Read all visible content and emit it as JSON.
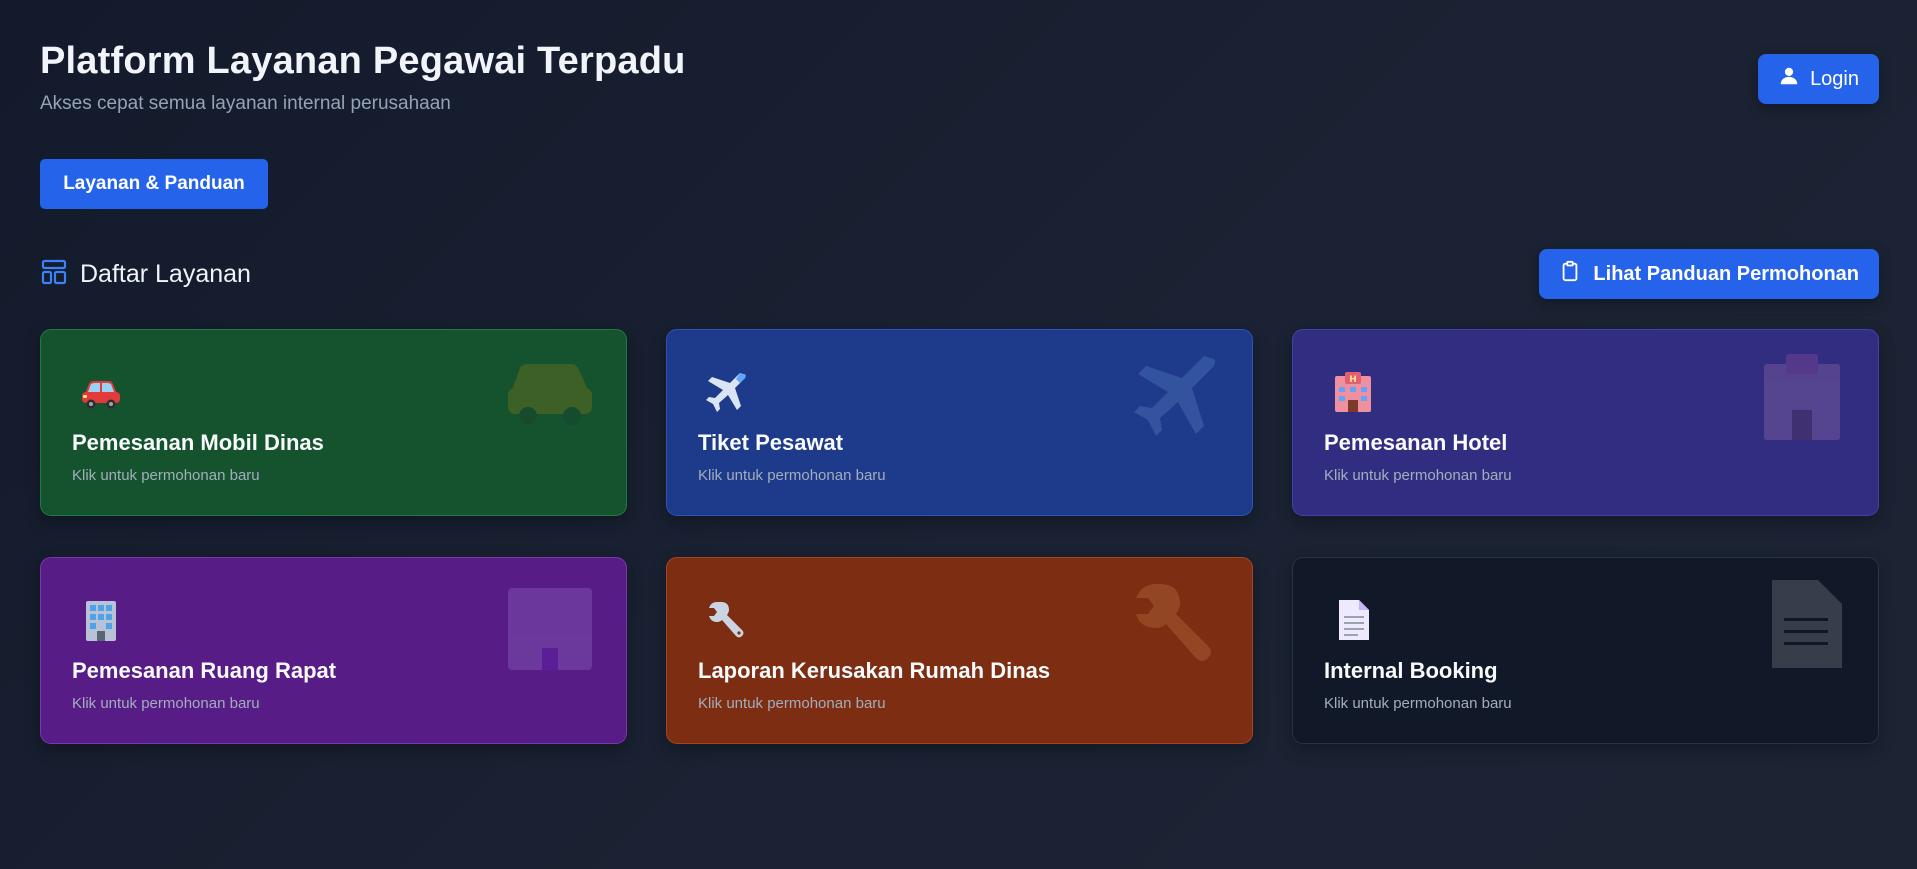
{
  "header": {
    "title": "Platform Layanan Pegawai Terpadu",
    "subtitle": "Akses cepat semua layanan internal perusahaan"
  },
  "login": {
    "label": "Login",
    "icon": "user-icon"
  },
  "guide_button": {
    "label": "Layanan & Panduan"
  },
  "section": {
    "title": "Daftar Layanan",
    "icon": "layout-icon"
  },
  "panduan_button": {
    "label": "Lihat Panduan Permohonan",
    "icon": "clipboard-icon"
  },
  "colors": {
    "accent": "#2563eb",
    "background": "#161d2d",
    "card_green": "#14532d",
    "card_blue": "#1e3a8a",
    "card_indigo": "#312e81",
    "card_purple": "#581c87",
    "card_orange": "#7c2d12",
    "card_dark": "#111827"
  },
  "services": [
    {
      "title": "Pemesanan Mobil Dinas",
      "subtitle": "Klik untuk permohonan baru",
      "icon": "car-icon"
    },
    {
      "title": "Tiket Pesawat",
      "subtitle": "Klik untuk permohonan baru",
      "icon": "airplane-icon"
    },
    {
      "title": "Pemesanan Hotel",
      "subtitle": "Klik untuk permohonan baru",
      "icon": "hotel-icon"
    },
    {
      "title": "Pemesanan Ruang Rapat",
      "subtitle": "Klik untuk permohonan baru",
      "icon": "office-building-icon"
    },
    {
      "title": "Laporan Kerusakan Rumah Dinas",
      "subtitle": "Klik untuk permohonan baru",
      "icon": "wrench-icon"
    },
    {
      "title": "Internal Booking",
      "subtitle": "Klik untuk permohonan baru",
      "icon": "document-icon"
    }
  ]
}
